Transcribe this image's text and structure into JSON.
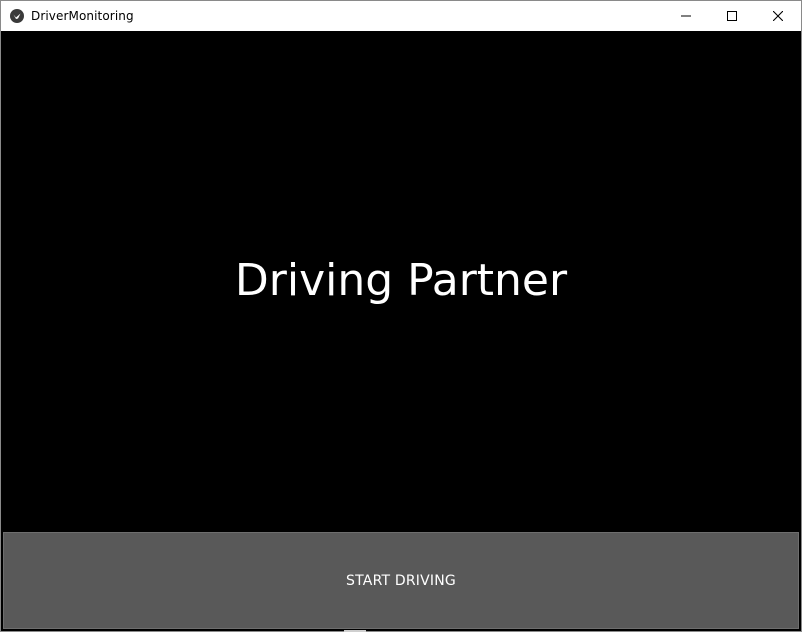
{
  "window": {
    "title": "DriverMonitoring",
    "icon": "kivy-app-icon",
    "controls": {
      "minimize_icon": "minimize-icon",
      "maximize_icon": "maximize-icon",
      "close_icon": "close-icon"
    }
  },
  "main": {
    "headline": "Driving Partner"
  },
  "actions": {
    "start_label": "START DRIVING"
  },
  "colors": {
    "background": "#000000",
    "titlebar": "#ffffff",
    "button": "#595959",
    "text": "#ffffff"
  }
}
